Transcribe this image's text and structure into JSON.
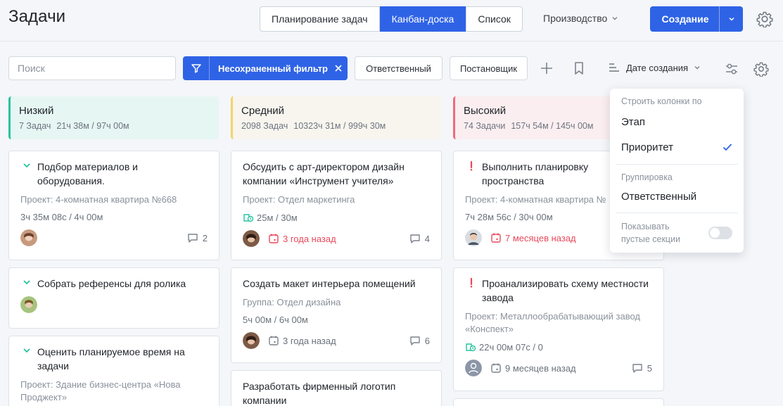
{
  "header": {
    "title": "Задачи",
    "views": [
      {
        "label": "Планирование задач",
        "active": false
      },
      {
        "label": "Канбан-доска",
        "active": true
      },
      {
        "label": "Список",
        "active": false
      }
    ],
    "production_menu": "Производство",
    "create_label": "Создание"
  },
  "toolbar": {
    "search_placeholder": "Поиск",
    "filter_label": "Несохраненный фильтр",
    "assignee_label": "Ответственный",
    "author_label": "Постановщик",
    "sort_label": "Дате создания"
  },
  "columns": [
    {
      "title": "Низкий",
      "count": "7 Задач",
      "time": "21ч 38м / 97ч 00м",
      "accent": "#27c3a0",
      "bg": "#e6f6f3",
      "cards": [
        {
          "title": "Подбор материалов и оборудования.",
          "project": "Проект: 4-комнатная квартира №668",
          "time": "3ч 35м 08с / 4ч 00м",
          "comments": "2"
        },
        {
          "title": "Собрать референсы для ролика"
        },
        {
          "title": "Оценить планируемое время на задачи",
          "project": "Проект: Здание бизнес-центра «Нова Проджект»"
        }
      ]
    },
    {
      "title": "Средний",
      "count": "2098 Задач",
      "time": "10323ч 31м / 999ч 30м",
      "accent": "#f2d36b",
      "bg": "#f7f5ee",
      "cards": [
        {
          "title": "Обсудить с арт-директором дизайн компании «Инструмент учителя»",
          "project": "Проект: Отдел маркетинга",
          "time": "25м / 30м",
          "due": "3 года назад",
          "comments": "4"
        },
        {
          "title": "Создать макет интерьера помещений",
          "project": "Группа: Отдел дизайна",
          "time": "5ч 00м / 6ч 00м",
          "due": "3 года назад",
          "comments": "6"
        },
        {
          "title": "Разработать фирменный логотип компании"
        }
      ]
    },
    {
      "title": "Высокий",
      "count": "74 Задачи",
      "time": "157ч 54м / 145ч 00м",
      "accent": "#f06b7a",
      "bg": "#fbeef0",
      "cards": [
        {
          "title": "Выполнить планировку пространства",
          "project": "Проект: 4-комнатная квартира №",
          "time": "7ч 28м 56с / 30ч 00м",
          "due": "7 месяцев назад"
        },
        {
          "title": "Проанализировать схему местности завода",
          "project": "Проект: Металлообрабатывающий завод «Конспект»",
          "time": "22ч 00м 07с / 0",
          "due": "9 месяцев назад",
          "comments": "5"
        }
      ]
    }
  ],
  "dropdown": {
    "build_label": "Строить колонки по",
    "stage": "Этап",
    "priority": "Приоритет",
    "group_label": "Группировка",
    "assignee": "Ответственный",
    "show_empty": "Показывать пустые секции"
  },
  "colors": {
    "primary": "#2f63e6",
    "overdue": "#e8495c",
    "neutral_icon": "#7b828c",
    "done_check": "#27c3a0"
  },
  "icons": [
    "settings-icon",
    "funnel-icon",
    "close-icon",
    "plus-icon",
    "bookmark-icon",
    "sort-icon",
    "sliders-icon",
    "chevron-down-icon",
    "calendar-icon",
    "comment-icon",
    "exclamation-icon",
    "time-icon",
    "check-icon"
  ]
}
